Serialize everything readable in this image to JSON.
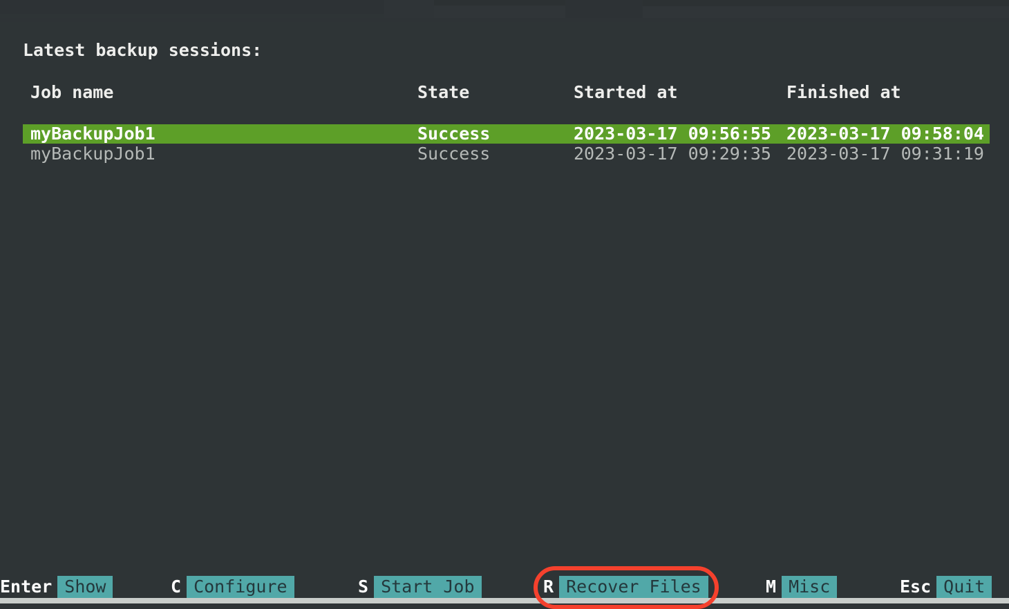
{
  "app": {
    "background_color": "#2e3436",
    "accent_green": "#5d9f28",
    "accent_teal": "#51a8a8",
    "annotation_color": "#f5412d"
  },
  "main": {
    "title": "Latest backup sessions:",
    "table": {
      "columns": [
        "Job name",
        "State",
        "Started at",
        "Finished at"
      ],
      "rows": [
        {
          "job_name": "myBackupJob1",
          "state": "Success",
          "started_at": "2023-03-17 09:56:55",
          "finished_at": "2023-03-17 09:58:04",
          "selected": true
        },
        {
          "job_name": "myBackupJob1",
          "state": "Success",
          "started_at": "2023-03-17 09:29:35",
          "finished_at": "2023-03-17 09:31:19",
          "selected": false
        }
      ]
    }
  },
  "keybar": {
    "items": [
      {
        "key": "Enter",
        "label": "Show"
      },
      {
        "key": "C",
        "label": "Configure"
      },
      {
        "key": "S",
        "label": "Start Job"
      },
      {
        "key": "R",
        "label": "Recover Files"
      },
      {
        "key": "M",
        "label": "Misc"
      },
      {
        "key": "Esc",
        "label": "Quit"
      }
    ]
  },
  "annotation": {
    "target": "Recover Files",
    "shape": "ellipse"
  }
}
